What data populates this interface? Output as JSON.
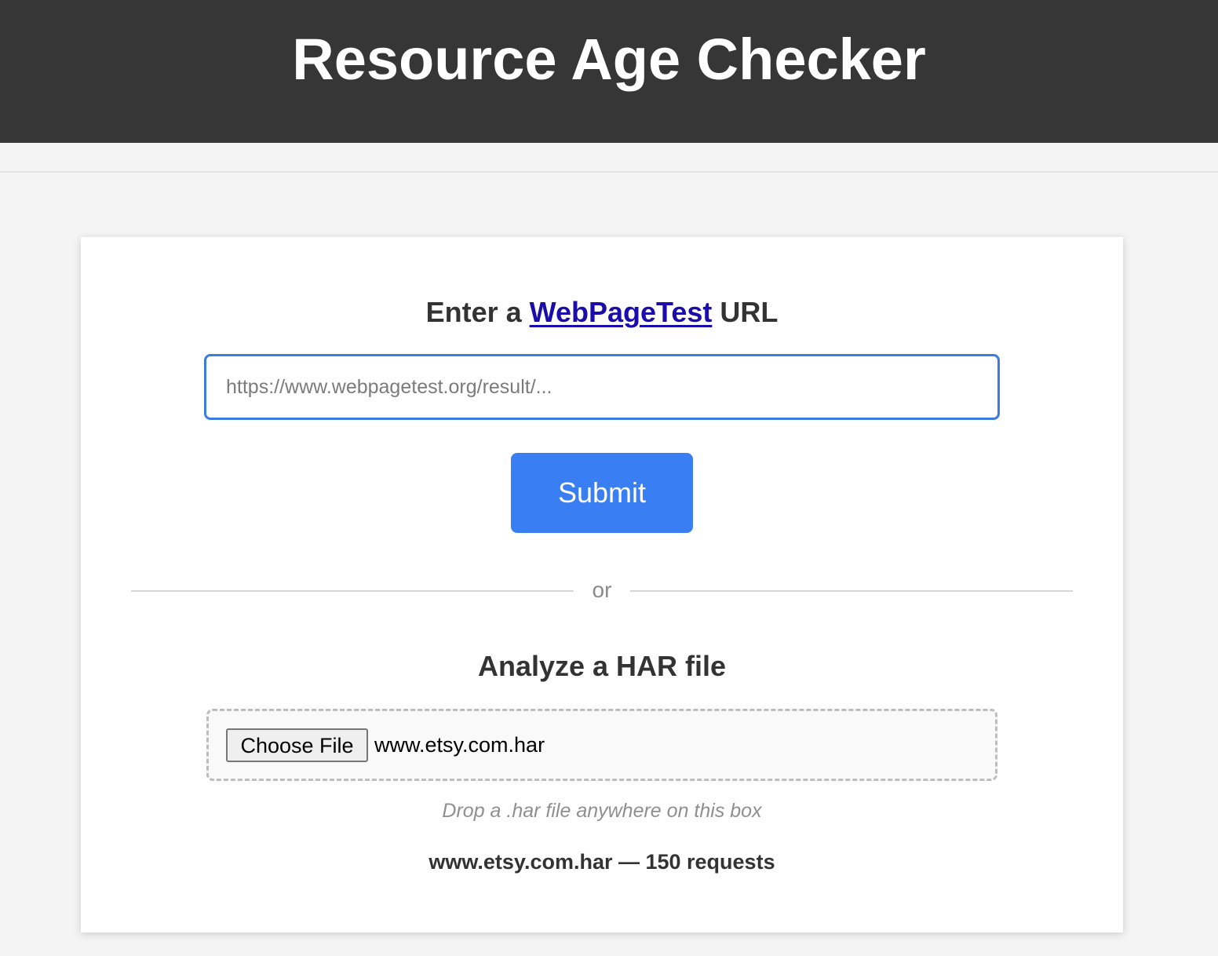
{
  "header": {
    "title": "Resource Age Checker"
  },
  "url_section": {
    "title_prefix": "Enter a ",
    "title_link": "WebPageTest",
    "title_suffix": " URL",
    "input_placeholder": "https://www.webpagetest.org/result/...",
    "input_value": "",
    "submit_label": "Submit"
  },
  "divider": {
    "label": "or"
  },
  "har_section": {
    "title": "Analyze a HAR file",
    "choose_file_label": "Choose File",
    "selected_file": "www.etsy.com.har",
    "drop_hint": "Drop a .har file anywhere on this box",
    "status": "www.etsy.com.har — 150 requests"
  },
  "colors": {
    "header_bg": "#363636",
    "accent": "#3a7ef3",
    "input_border": "#3b7ddd",
    "link": "#1a0dab"
  }
}
